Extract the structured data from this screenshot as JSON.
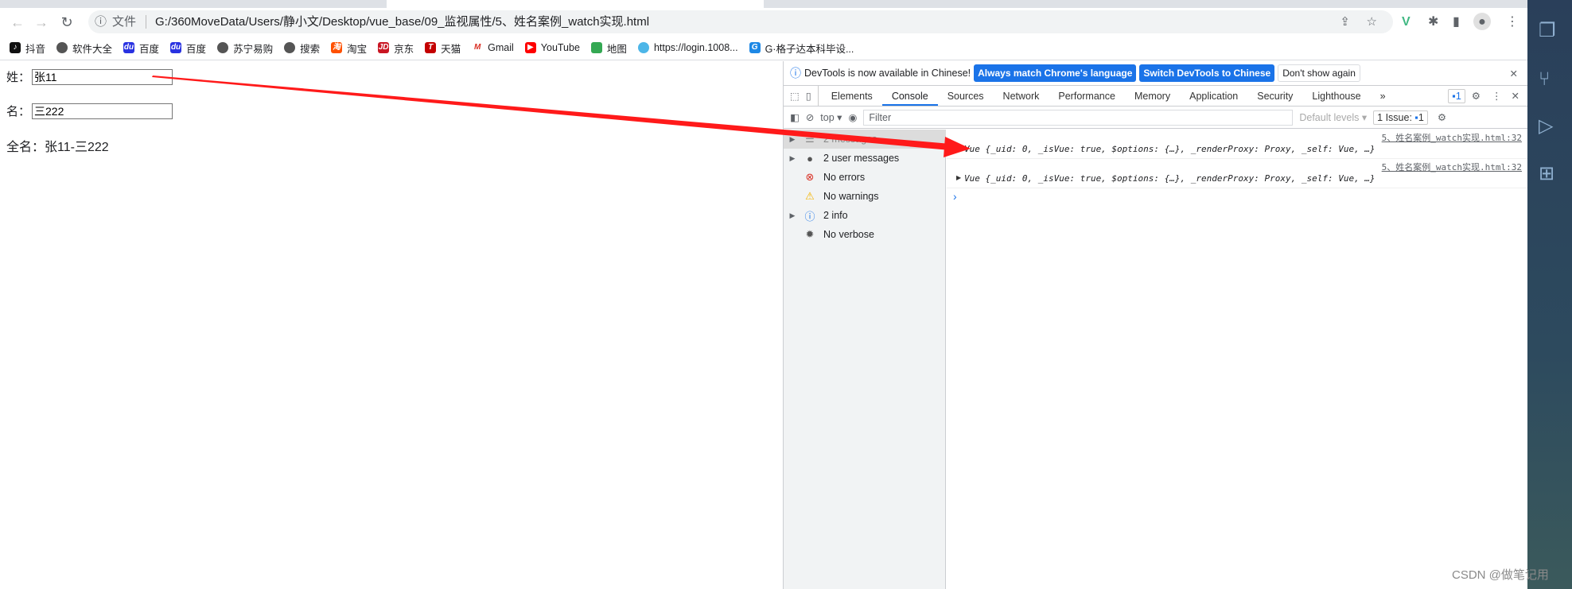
{
  "browser": {
    "url_scheme": "文件",
    "url": "G:/360MoveData/Users/静小文/Desktop/vue_base/09_监视属性/5、姓名案例_watch实现.html",
    "bookmarks": [
      "抖音",
      "软件大全",
      "百度",
      "百度",
      "苏宁易购",
      "搜索",
      "淘宝",
      "京东",
      "天猫",
      "Gmail",
      "YouTube",
      "地图",
      "https://login.1008...",
      "G·格子达本科毕设..."
    ]
  },
  "page": {
    "first_name_label": "姓：",
    "first_name_value": "张11",
    "last_name_label": "名：",
    "last_name_value": "三222",
    "full_name": "全名：张11-三222"
  },
  "devtools": {
    "infobar": {
      "text": "DevTools is now available in Chinese!",
      "btn_match": "Always match Chrome's language",
      "btn_switch": "Switch DevTools to Chinese",
      "btn_dont": "Don't show again"
    },
    "tabs": [
      "Elements",
      "Console",
      "Sources",
      "Network",
      "Performance",
      "Memory",
      "Application",
      "Security",
      "Lighthouse"
    ],
    "active_tab": "Console",
    "issues_badge": "1",
    "toolbar": {
      "context": "top",
      "filter_placeholder": "Filter",
      "levels": "Default levels",
      "issues": "1 Issue:",
      "issues_count": "1"
    },
    "sidebar": [
      {
        "label": "2 messages",
        "icon": "list-icon"
      },
      {
        "label": "2 user messages",
        "icon": "user-icon"
      },
      {
        "label": "No errors",
        "icon": "error-icon"
      },
      {
        "label": "No warnings",
        "icon": "warning-icon"
      },
      {
        "label": "2 info",
        "icon": "info-icon"
      },
      {
        "label": "No verbose",
        "icon": "bug-icon"
      }
    ],
    "messages": [
      {
        "source": "5、姓名案例_watch实现.html:32",
        "text": "Vue {_uid: 0, _isVue: true, $options: {…}, _renderProxy: Proxy, _self: Vue, …}"
      },
      {
        "source": "5、姓名案例_watch实现.html:32",
        "text": "Vue {_uid: 0, _isVue: true, $options: {…}, _renderProxy: Proxy, _self: Vue, …}"
      }
    ]
  },
  "watermark": "CSDN @做笔记用",
  "colors": {
    "accent": "#1a73e8",
    "arrow": "#ff1a1a"
  }
}
